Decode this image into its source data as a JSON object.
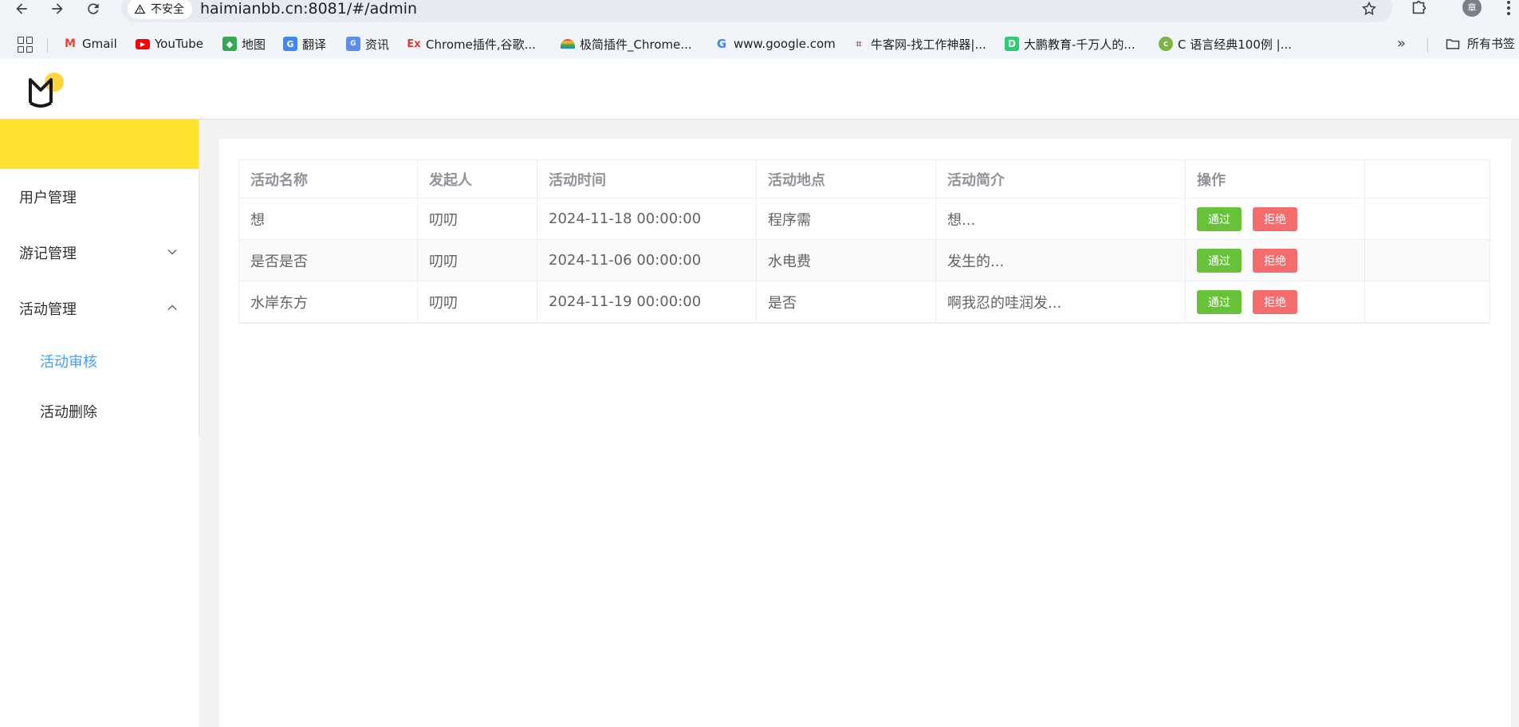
{
  "browser": {
    "security_label": "不安全",
    "url": "haimianbb.cn:8081/#/admin",
    "profile_initial": "章",
    "bookmarks": [
      {
        "label": "Gmail",
        "icon": "gmail-icon"
      },
      {
        "label": "YouTube",
        "icon": "youtube-icon"
      },
      {
        "label": "地图",
        "icon": "maps-icon"
      },
      {
        "label": "翻译",
        "icon": "translate-icon"
      },
      {
        "label": "资讯",
        "icon": "news-icon"
      },
      {
        "label": "Chrome插件,谷歌...",
        "icon": "ex-icon"
      },
      {
        "label": "极简插件_Chrome...",
        "icon": "rainbow-icon"
      },
      {
        "label": "www.google.com",
        "icon": "google-icon"
      },
      {
        "label": "牛客网-找工作神器|...",
        "icon": "nowcoder-icon"
      },
      {
        "label": "大鹏教育-千万人的...",
        "icon": "dapeng-icon"
      },
      {
        "label": "C 语言经典100例 |...",
        "icon": "runoob-icon"
      }
    ],
    "all_bookmarks_label": "所有书签"
  },
  "sidebar": {
    "items": [
      {
        "label": "用户管理"
      },
      {
        "label": "游记管理",
        "expanded": false
      },
      {
        "label": "活动管理",
        "expanded": true
      }
    ],
    "sub_items": [
      {
        "label": "活动审核",
        "active": true
      },
      {
        "label": "活动删除",
        "active": false
      }
    ]
  },
  "table": {
    "columns": [
      "活动名称",
      "发起人",
      "活动时间",
      "活动地点",
      "活动简介",
      "操作"
    ],
    "rows": [
      {
        "name": "想",
        "initiator": "叨叨",
        "time": "2024-11-18 00:00:00",
        "place": "程序需",
        "intro": "想..."
      },
      {
        "name": "是否是否",
        "initiator": "叨叨",
        "time": "2024-11-06 00:00:00",
        "place": "水电费",
        "intro": "发生的..."
      },
      {
        "name": "水岸东方",
        "initiator": "叨叨",
        "time": "2024-11-19 00:00:00",
        "place": "是否",
        "intro": "啊我忍的哇润发..."
      }
    ],
    "approve_label": "通过",
    "reject_label": "拒绝"
  },
  "colors": {
    "brand_yellow": "#ffe22f",
    "approve_green": "#67c23a",
    "reject_red": "#f56c6c",
    "active_blue": "#409eff"
  }
}
